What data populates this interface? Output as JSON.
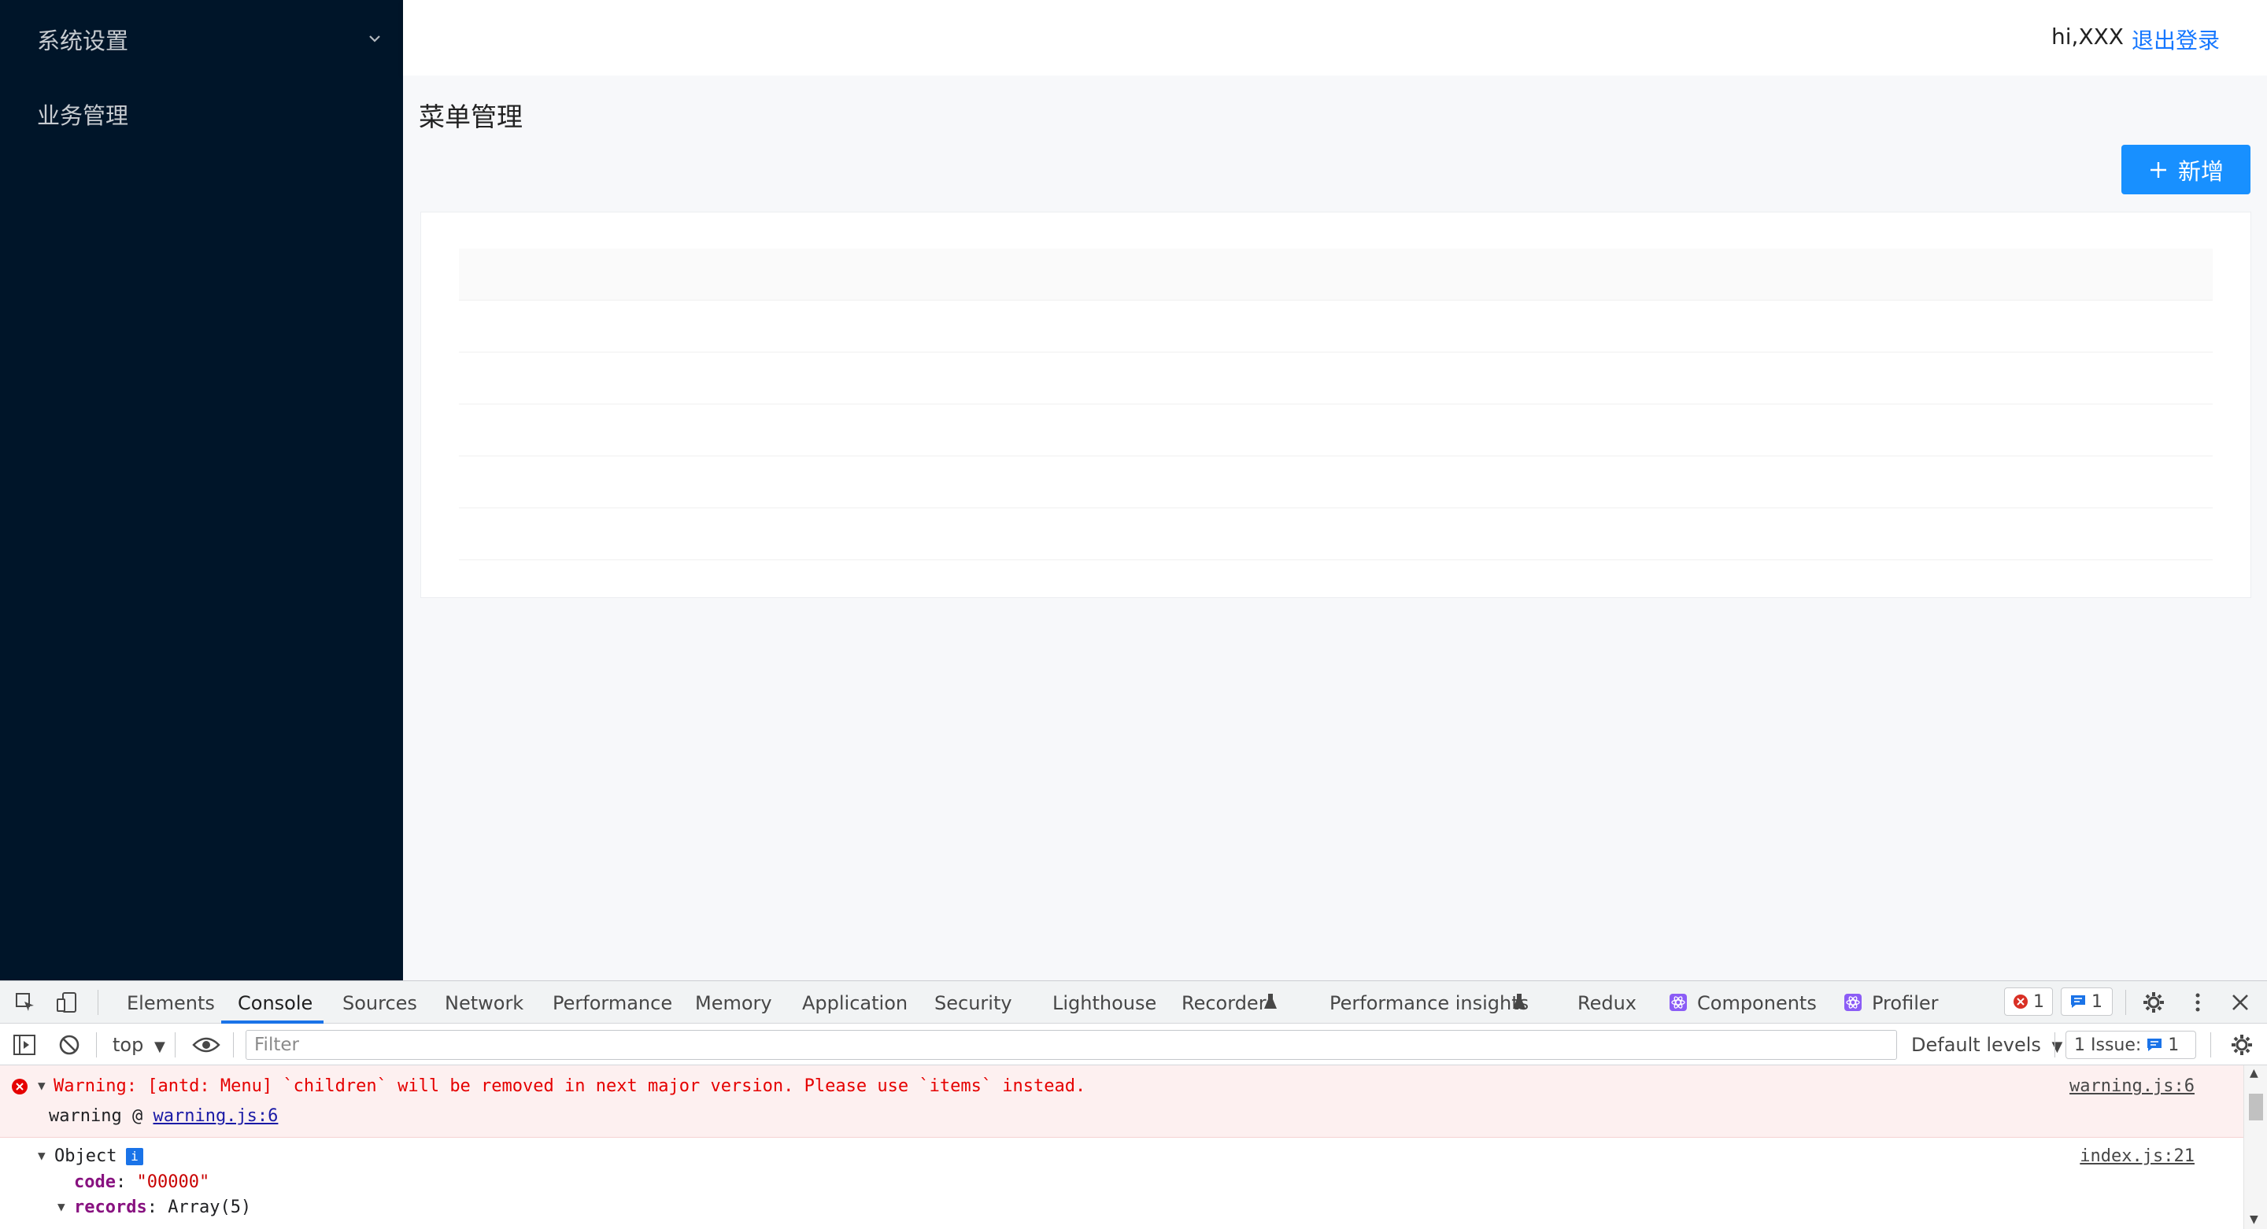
{
  "sidebar": {
    "items": [
      {
        "label": "系统设置"
      },
      {
        "label": "业务管理"
      }
    ]
  },
  "header": {
    "greeting": "hi,XXX",
    "logout": "退出登录"
  },
  "main": {
    "title": "菜单管理",
    "add_button": "新增"
  },
  "devtools": {
    "tabs": [
      "Elements",
      "Console",
      "Sources",
      "Network",
      "Performance",
      "Memory",
      "Application",
      "Security",
      "Lighthouse",
      "Recorder",
      "Performance insights",
      "Redux",
      "Components",
      "Profiler"
    ],
    "active_tab": "Console",
    "error_count": "1",
    "message_count": "1",
    "toolbar": {
      "context": "top",
      "filter_placeholder": "Filter",
      "levels": "Default levels",
      "issues_label": "1 Issue:",
      "issues_count": "1"
    },
    "console": {
      "warning": "Warning: [antd: Menu] `children` will be removed in next major version. Please use `items` instead.",
      "warning_sub_text": "warning @",
      "warning_sub_link": "warning.js:6",
      "warning_source": "warning.js:6",
      "object_label": "Object",
      "object_source": "index.js:21",
      "code_key": "code",
      "code_value": "\"00000\"",
      "records_key": "records",
      "records_value": "Array(5)"
    }
  },
  "colors": {
    "sidebar_bg": "#001529",
    "primary": "#1890ff",
    "link": "#1677ff",
    "error": "#e50000"
  }
}
